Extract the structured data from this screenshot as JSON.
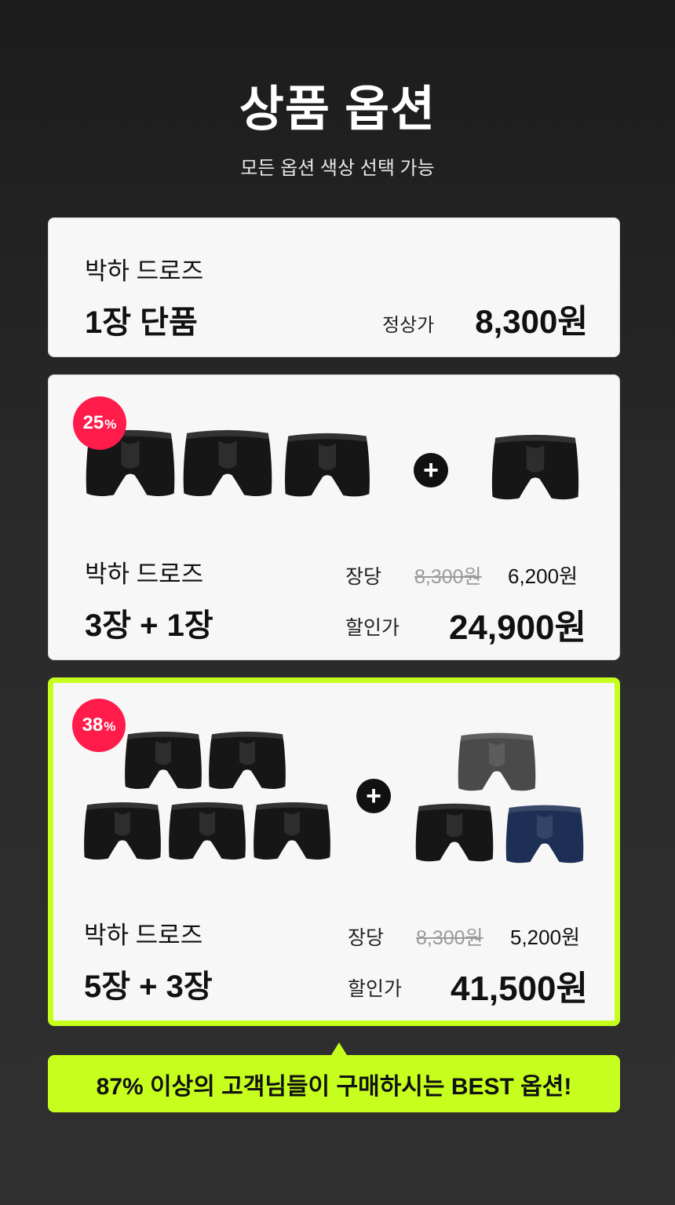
{
  "header": {
    "title": "상품 옵션",
    "subtitle": "모든 옵션 색상 선택 가능"
  },
  "options": [
    {
      "name": "박하 드로즈",
      "quantity": "1장 단품",
      "price_label": "정상가",
      "price": "8,300원"
    },
    {
      "badge_value": "25",
      "badge_unit": "%",
      "name": "박하 드로즈",
      "quantity": "3장 + 1장",
      "per_label": "장당",
      "original_price": "8,300원",
      "unit_price": "6,200원",
      "sale_label": "할인가",
      "total_price": "24,900원",
      "plus_symbol": "+",
      "briefs_colors": [
        "black",
        "black",
        "black",
        "black"
      ]
    },
    {
      "badge_value": "38",
      "badge_unit": "%",
      "name": "박하 드로즈",
      "quantity": "5장 + 3장",
      "per_label": "장당",
      "original_price": "8,300원",
      "unit_price": "5,200원",
      "sale_label": "할인가",
      "total_price": "41,500원",
      "plus_symbol": "+",
      "briefs_colors": [
        "black",
        "black",
        "black",
        "black",
        "black",
        "gray",
        "black",
        "navy"
      ],
      "highlight_color": "#c6ff1e"
    }
  ],
  "callout": {
    "text": "87% 이상의 고객님들이 구매하시는 BEST 옵션!"
  },
  "colors": {
    "accent": "#c6ff1e",
    "badge": "#ff1b4a",
    "black": "#111111",
    "gray": "#4a4a4a",
    "navy": "#1e2f55"
  }
}
